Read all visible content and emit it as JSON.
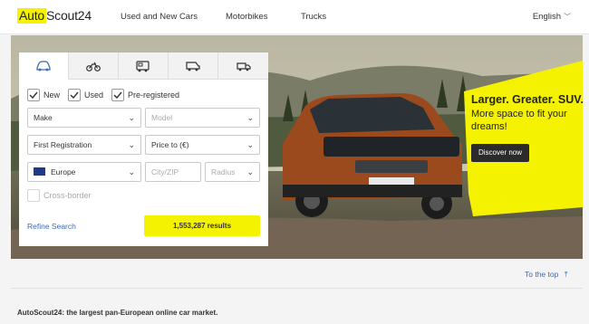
{
  "header": {
    "logo_part1": "Auto",
    "logo_part2": "Scout24",
    "nav": [
      "Used and New Cars",
      "Motorbikes",
      "Trucks"
    ],
    "language": "English"
  },
  "search": {
    "tabs": [
      "car-icon",
      "motorbike-icon",
      "camper-icon",
      "van-icon",
      "truck-icon"
    ],
    "checkboxes": [
      {
        "label": "New",
        "checked": true
      },
      {
        "label": "Used",
        "checked": true
      },
      {
        "label": "Pre-registered",
        "checked": true
      }
    ],
    "make": "Make",
    "model": "Model",
    "first_registration": "First Registration",
    "price_to": "Price to (€)",
    "region": "Europe",
    "city_zip": "City/ZIP",
    "radius": "Radius",
    "cross_border": "Cross-border",
    "refine_label": "Refine Search",
    "results_label": "1,553,287 results"
  },
  "promo": {
    "title": "Larger. Greater. SUV.",
    "subtitle": "More space to fit your dreams!",
    "button": "Discover now",
    "accent": "#f5f200"
  },
  "footer": {
    "to_top": "To the top",
    "tagline": "AutoScout24: the largest pan-European online car market."
  }
}
